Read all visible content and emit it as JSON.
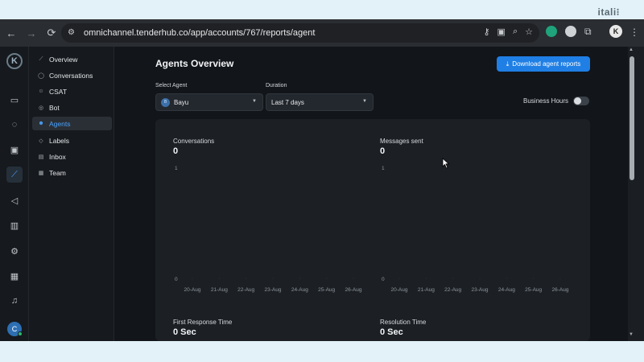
{
  "top_strip": {
    "brand": "itali⁝"
  },
  "browser": {
    "url": "omnichannel.tenderhub.co/app/accounts/767/reports/agent",
    "profile_initial": "K"
  },
  "rail": {
    "logo_initial": "K",
    "avatar_initial": "C"
  },
  "subnav": {
    "items": [
      {
        "label": "Overview",
        "icon": "trend-icon"
      },
      {
        "label": "Conversations",
        "icon": "chat-icon"
      },
      {
        "label": "CSAT",
        "icon": "smile-icon"
      },
      {
        "label": "Bot",
        "icon": "bot-icon"
      },
      {
        "label": "Agents",
        "icon": "people-icon",
        "active": true
      },
      {
        "label": "Labels",
        "icon": "tag-icon"
      },
      {
        "label": "Inbox",
        "icon": "inbox-icon"
      },
      {
        "label": "Team",
        "icon": "team-icon"
      }
    ]
  },
  "page": {
    "title": "Agents Overview",
    "download_button": "Download agent reports",
    "select_agent_label": "Select Agent",
    "agent_value": "Bayu",
    "agent_avatar_initial": "B",
    "duration_label": "Duration",
    "duration_value": "Last 7 days",
    "business_hours_label": "Business Hours",
    "business_hours_on": false
  },
  "metrics": {
    "conversations": {
      "title": "Conversations",
      "value": "0"
    },
    "messages_sent": {
      "title": "Messages sent",
      "value": "0"
    },
    "first_response": {
      "title": "First Response Time",
      "value": "0 Sec"
    },
    "resolution": {
      "title": "Resolution Time",
      "value": "0 Sec"
    }
  },
  "chart_data": [
    {
      "type": "line",
      "title": "Conversations",
      "categories": [
        "20-Aug",
        "21-Aug",
        "22-Aug",
        "23-Aug",
        "24-Aug",
        "25-Aug",
        "26-Aug"
      ],
      "series": [
        {
          "values": [
            0,
            0,
            0,
            0,
            0,
            0,
            0
          ]
        }
      ],
      "ylim": [
        0,
        1
      ],
      "yticks": [
        "1",
        "0"
      ]
    },
    {
      "type": "line",
      "title": "Messages sent",
      "categories": [
        "20-Aug",
        "21-Aug",
        "22-Aug",
        "23-Aug",
        "24-Aug",
        "25-Aug",
        "26-Aug"
      ],
      "series": [
        {
          "values": [
            0,
            0,
            0,
            0,
            0,
            0,
            0
          ]
        }
      ],
      "ylim": [
        0,
        1
      ],
      "yticks": [
        "1",
        "0"
      ]
    }
  ],
  "colors": {
    "accent": "#1f7fe5",
    "active_nav": "#4aa3ff"
  }
}
